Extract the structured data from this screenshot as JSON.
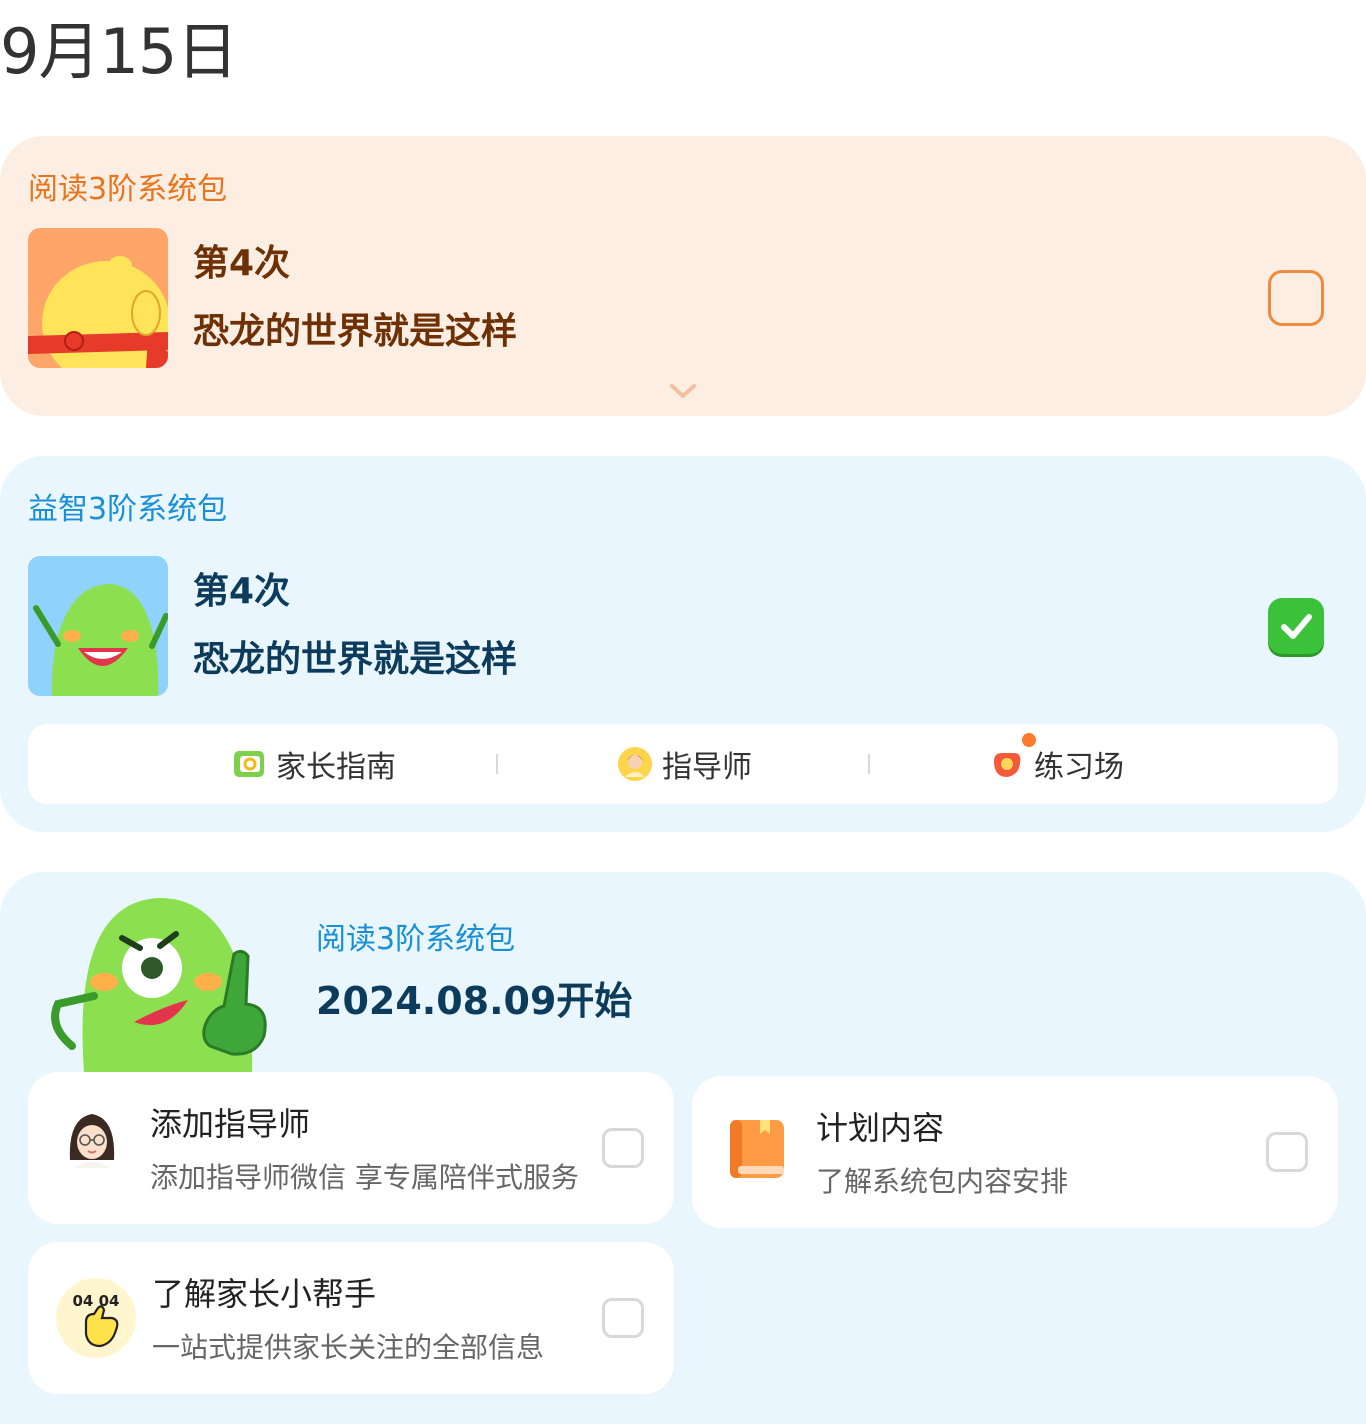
{
  "header": {
    "date": "9月15日"
  },
  "card1": {
    "package_label": "阅读3阶系统包",
    "session": "第4次",
    "lesson": "恐龙的世界就是这样",
    "completed": false,
    "accent_color": "#e8741b",
    "expand_icon": "chevron-down-icon"
  },
  "card2": {
    "package_label": "益智3阶系统包",
    "session": "第4次",
    "lesson": "恐龙的世界就是这样",
    "completed": true,
    "accent_color": "#1a8fd6",
    "toolbar": [
      {
        "label": "家长指南",
        "icon": "parent-guide-icon"
      },
      {
        "label": "指导师",
        "icon": "tutor-avatar-icon"
      },
      {
        "label": "练习场",
        "icon": "practice-icon",
        "badge_dot": true
      }
    ]
  },
  "plan": {
    "package_label": "阅读3阶系统包",
    "start_text": "2024.08.09开始",
    "tasks": [
      {
        "title": "添加指导师",
        "subtitle": "添加指导师微信 享专属陪伴式服务",
        "icon": "tutor-girl-icon",
        "done": false
      },
      {
        "title": "计划内容",
        "subtitle": "了解系统包内容安排",
        "icon": "book-icon",
        "done": false
      },
      {
        "title": "了解家长小帮手",
        "subtitle": "一站式提供家长关注的全部信息",
        "icon": "helper-thumbs-up-icon",
        "done": false
      }
    ]
  },
  "colors": {
    "orange_card_bg": "#fdeee4",
    "blue_card_bg": "#e9f6fd",
    "check_green": "#3cc13b",
    "checkbox_orange": "#f08a3c"
  }
}
